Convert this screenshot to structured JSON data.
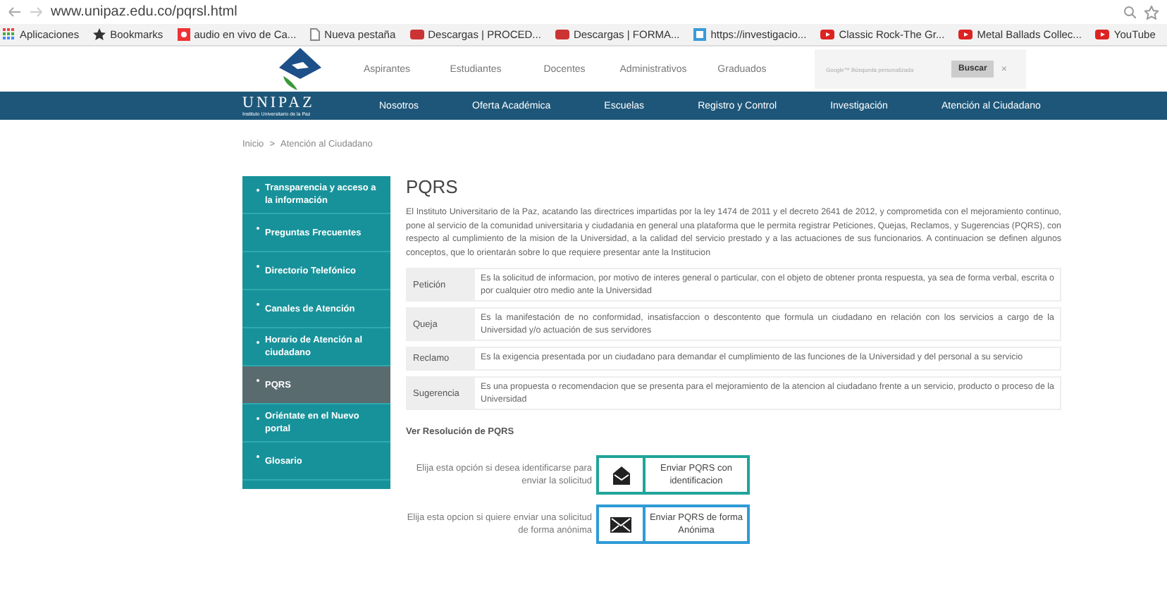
{
  "browser": {
    "url": "www.unipaz.edu.co/pqrsl.html",
    "bookmarks": [
      {
        "label": "Aplicaciones",
        "kind": "apps"
      },
      {
        "label": "Bookmarks",
        "kind": "star"
      },
      {
        "label": "audio en vivo de Ca...",
        "kind": "red"
      },
      {
        "label": "Nueva pestaña",
        "kind": "page"
      },
      {
        "label": "Descargas | PROCED...",
        "kind": "sena"
      },
      {
        "label": "Descargas | FORMA...",
        "kind": "sena"
      },
      {
        "label": "https://investigacio...",
        "kind": "blue"
      },
      {
        "label": "Classic Rock-The Gr...",
        "kind": "youtube"
      },
      {
        "label": "Metal Ballads Collec...",
        "kind": "youtube"
      },
      {
        "label": "YouTube",
        "kind": "youtube"
      }
    ]
  },
  "top_links": [
    "Aspirantes",
    "Estudiantes",
    "Docentes",
    "Administrativos",
    "Graduados"
  ],
  "search": {
    "placeholder": "Google™ Búsqueda personalizada",
    "button": "Buscar",
    "clear": "×"
  },
  "brand": {
    "name": "UNIPAZ",
    "subtitle": "Instituto Universitario de la Paz"
  },
  "main_nav": [
    "Nosotros",
    "Oferta Académica",
    "Escuelas",
    "Registro y Control",
    "Investigación",
    "Atención al Ciudadano"
  ],
  "breadcrumb": [
    "Inicio",
    "Atención al Ciudadano"
  ],
  "breadcrumb_separator": ">",
  "sidebar": [
    {
      "label": "Transparencia y acceso a la información",
      "selected": false
    },
    {
      "label": "Preguntas Frecuentes",
      "selected": false
    },
    {
      "label": "Directorio Telefónico",
      "selected": false
    },
    {
      "label": "Canales de Atención",
      "selected": false
    },
    {
      "label": "Horario de Atención al ciudadano",
      "selected": false
    },
    {
      "label": "PQRS",
      "selected": true
    },
    {
      "label": "Oriéntate en el Nuevo portal",
      "selected": false
    },
    {
      "label": "Glosario",
      "selected": false
    }
  ],
  "title": "PQRS",
  "intro": "El Instituto Universitario de la Paz, acatando las directrices impartidas por la ley 1474 de 2011 y el decreto 2641 de 2012, y comprometida con el mejoramiento continuo, pone al servicio de la comunidad universitaria y ciudadania en general una plataforma que le permita registrar Peticiones, Quejas, Reclamos, y Sugerencias (PQRS), con respecto al cumplimiento de la mision de la Universidad, a la calidad del servicio prestado y a las actuaciones de sus funcionarios. A continuacion se definen algunos conceptos, que lo orientarán sobre lo que requiere presentar ante la Institucion",
  "definitions": [
    {
      "term": "Petición",
      "text": "Es la solicitud de informacion,  por  motivo de interes general o particular, con el objeto de obtener pronta respuesta, ya sea de forma verbal, escrita o por cualquier otro medio ante la Universidad"
    },
    {
      "term": "Queja",
      "text": "Es la manifestación de no conformidad, insatisfaccion o descontento que formula un ciudadano en relación con los servicios a cargo de la Universidad  y/o actuación de sus servidores"
    },
    {
      "term": "Reclamo",
      "text": "Es la exigencia presentada por un ciudadano para demandar el cumplimiento de las funciones de la Universidad y del personal a su servicio"
    },
    {
      "term": "Sugerencia",
      "text": "Es una propuesta o recomendacion que se presenta para el mejoramiento de la atencion al ciudadano frente a un servicio, producto o proceso de la Universidad"
    }
  ],
  "resolution_link": "Ver Resolución de PQRS",
  "options": [
    {
      "hint": "Elija esta opción si desea identificarse para enviar la solicitud",
      "button": "Enviar PQRS con identificacion",
      "color": "#1fa59a",
      "kind": "open"
    },
    {
      "hint": "Elija esta opcion si quiere enviar una solicitud de forma anónima",
      "button": "Enviar PQRS de forma Anónima",
      "color": "#2f9bd6",
      "kind": "closed"
    }
  ]
}
